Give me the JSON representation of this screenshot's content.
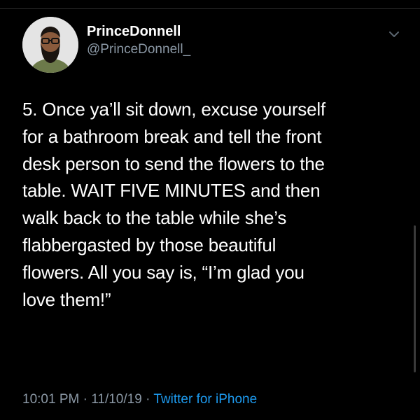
{
  "user": {
    "display_name": "PrinceDonnell",
    "handle": "@PrinceDonnell_"
  },
  "tweet": {
    "lines": [
      "5. Once ya’ll sit down, excuse yourself",
      "for a bathroom break and tell the front",
      "desk person to send the flowers to the",
      "table. WAIT FIVE MINUTES and then",
      "walk back to the table while she’s",
      "flabbergasted by those beautiful",
      "flowers. All you say is, “I’m glad you",
      "love them!”"
    ],
    "time": "10:01 PM",
    "separator": "·",
    "date": "11/10/19",
    "source": "Twitter for iPhone"
  },
  "icons": {
    "avatar": "avatar-photo",
    "menu": "chevron-down-icon"
  },
  "colors": {
    "background": "#000000",
    "text": "#ffffff",
    "muted": "#8b98a5",
    "link": "#1d9bf0"
  }
}
